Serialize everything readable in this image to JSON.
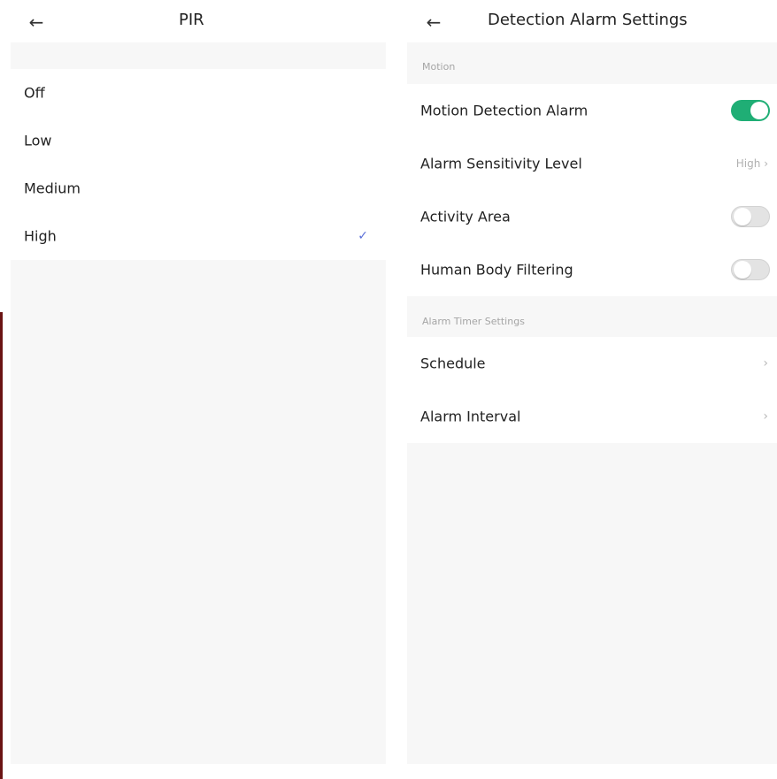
{
  "pir": {
    "title": "PIR",
    "options": [
      {
        "label": "Off"
      },
      {
        "label": "Low"
      },
      {
        "label": "Medium"
      },
      {
        "label": "High",
        "selected": true
      }
    ]
  },
  "detection": {
    "title": "Detection Alarm Settings",
    "motion_section": "Motion",
    "motion_items": [
      {
        "label": "Motion Detection Alarm",
        "toggle": "on"
      },
      {
        "label": "Alarm Sensitivity Level",
        "value": "High"
      },
      {
        "label": "Activity Area",
        "toggle": "off"
      },
      {
        "label": "Human Body Filtering",
        "toggle": "off"
      }
    ],
    "timer_section": "Alarm Timer Settings",
    "timer_items": [
      {
        "label": "Schedule"
      },
      {
        "label": "Alarm Interval"
      }
    ]
  },
  "colors": {
    "toggle_on": "#1fae75",
    "checkmark": "#5a6fd8",
    "page_bg": "#f7f7f7"
  },
  "icons": {
    "back": "left-arrow",
    "selected": "checkmark",
    "navigate": "chevron-right"
  }
}
